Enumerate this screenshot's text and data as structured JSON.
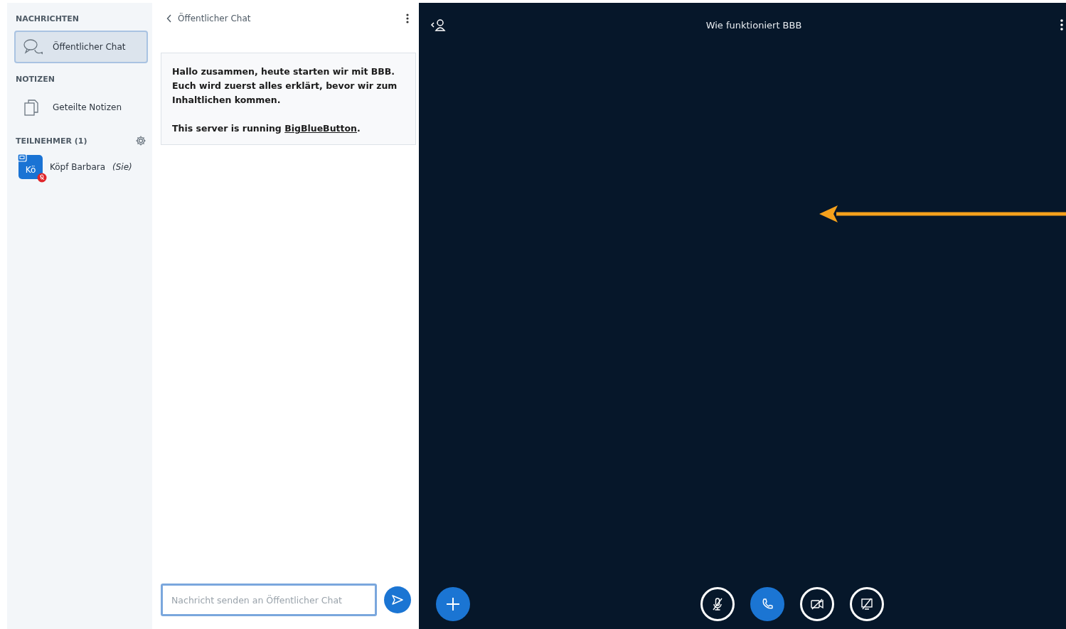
{
  "sidebar": {
    "sections": [
      {
        "title": "NACHRICHTEN",
        "items": [
          {
            "kind": "chat",
            "label": "Öffentlicher Chat",
            "selected": true
          }
        ]
      },
      {
        "title": "NOTIZEN",
        "items": [
          {
            "kind": "notes",
            "label": "Geteilte Notizen",
            "selected": false
          }
        ]
      },
      {
        "title": "TEILNEHMER (1)",
        "settings": true,
        "users": [
          {
            "initials": "Kö",
            "name": "Köpf Barbara",
            "suffix": "(Sie)",
            "color": "#1a73d4"
          }
        ]
      }
    ]
  },
  "chat": {
    "title": "Öffentlicher Chat",
    "messages": [
      {
        "paragraphs": [
          {
            "text": "Hallo zusammen, heute starten wir mit BBB. Euch wird zuerst alles erklärt, bevor wir zum Inhaltlichen kommen."
          },
          {
            "before": "This server is running ",
            "link": "BigBlueButton",
            "after": "."
          }
        ]
      }
    ],
    "input": {
      "placeholder": "Nachricht senden an Öffentlicher Chat"
    }
  },
  "presentation": {
    "title": "Wie funktioniert BBB",
    "actions": [
      {
        "kind": "mic",
        "active": false
      },
      {
        "kind": "phone",
        "active": true
      },
      {
        "kind": "camera",
        "active": false
      },
      {
        "kind": "screen",
        "active": false
      }
    ]
  }
}
